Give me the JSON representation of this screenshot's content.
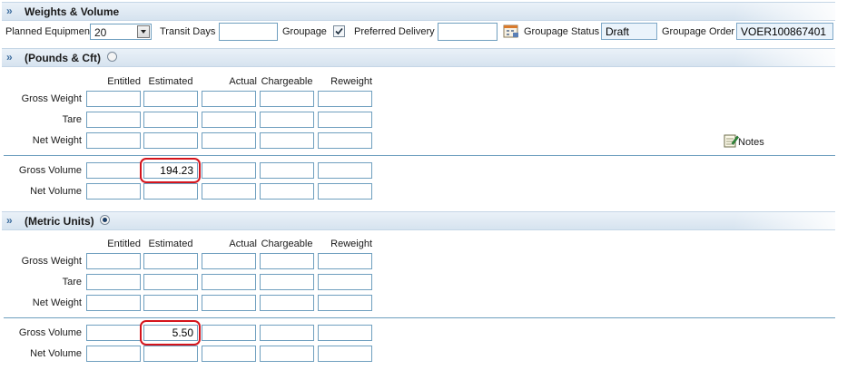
{
  "section": {
    "title": "Weights & Volume",
    "planned_equipment_label": "Planned Equipment",
    "planned_equipment_value": "20",
    "transit_days_label": "Transit Days",
    "transit_days_value": "",
    "groupage_label": "Groupage",
    "groupage_checked": true,
    "preferred_delivery_label": "Preferred Delivery",
    "preferred_delivery_value": "",
    "groupage_status_label": "Groupage Status",
    "groupage_status_value": "Draft",
    "groupage_order_label": "Groupage Order",
    "groupage_order_value": "VOER100867401"
  },
  "columns": [
    "Entitled",
    "Estimated",
    "Actual",
    "Chargeable",
    "Reweight"
  ],
  "imperial": {
    "title": "(Pounds & Cft)",
    "selected": false,
    "rows": {
      "gross_weight": {
        "label": "Gross Weight",
        "values": [
          "",
          "",
          "",
          "",
          ""
        ]
      },
      "tare": {
        "label": "Tare",
        "values": [
          "",
          "",
          "",
          "",
          ""
        ]
      },
      "net_weight": {
        "label": "Net Weight",
        "values": [
          "",
          "",
          "",
          "",
          ""
        ]
      },
      "gross_volume": {
        "label": "Gross Volume",
        "values": [
          "",
          "194.23",
          "",
          "",
          ""
        ]
      },
      "net_volume": {
        "label": "Net Volume",
        "values": [
          "",
          "",
          "",
          "",
          ""
        ]
      }
    },
    "notes_label": "Notes"
  },
  "metric": {
    "title": "(Metric Units)",
    "selected": true,
    "rows": {
      "gross_weight": {
        "label": "Gross Weight",
        "values": [
          "",
          "",
          "",
          "",
          ""
        ]
      },
      "tare": {
        "label": "Tare",
        "values": [
          "",
          "",
          "",
          "",
          ""
        ]
      },
      "net_weight": {
        "label": "Net Weight",
        "values": [
          "",
          "",
          "",
          "",
          ""
        ]
      },
      "gross_volume": {
        "label": "Gross Volume",
        "values": [
          "",
          "5.50",
          "",
          "",
          ""
        ]
      },
      "net_volume": {
        "label": "Net Volume",
        "values": [
          "",
          "",
          "",
          "",
          ""
        ]
      }
    }
  },
  "colors": {
    "accent": "#6f9fbf",
    "highlight": "#d4141c",
    "header": "#d6e3ef"
  }
}
